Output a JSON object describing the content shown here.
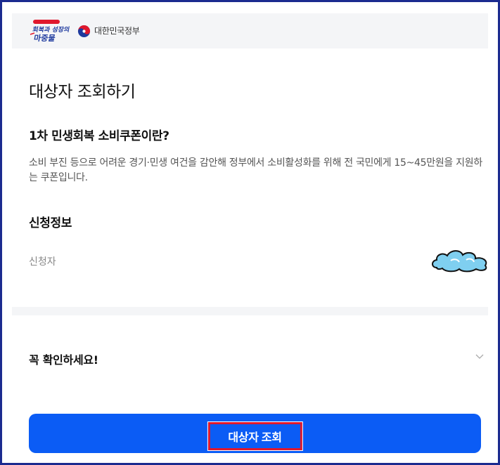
{
  "header": {
    "logo_text": "회복과 성장의 마중물",
    "gov_name": "대한민국정부",
    "colors": {
      "badge_red": "#e0182d",
      "badge_blue": "#1e3a9e"
    }
  },
  "main": {
    "page_title": "대상자 조회하기",
    "intro": {
      "heading": "1차 민생회복 소비쿠폰이란?",
      "description": "소비 부진 등으로 어려운 경기·민생 여건을 감안해 정부에서 소비활성화를 위해 전 국민에게 15~45만원을 지원하는 쿠폰입니다."
    },
    "application": {
      "heading": "신청정보",
      "applicant_label": "신청자"
    },
    "notice": {
      "title": "꼭 확인하세요!",
      "icon": "chevron-down-icon"
    },
    "cta": {
      "label": "대상자 조회",
      "color": "#0b5cf5"
    }
  }
}
